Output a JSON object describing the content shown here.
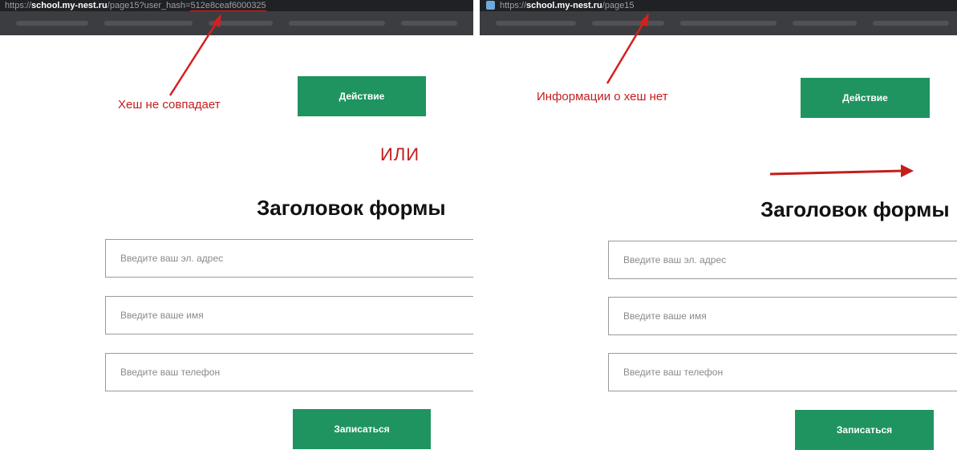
{
  "left": {
    "address": {
      "protocol": "https://",
      "domain": "school.my-nest.ru",
      "path": "/page15?user_hash=",
      "hash": "512e8ceaf6000325"
    },
    "annotation": "Хеш не совпадает",
    "action_button": "Действие",
    "or_label": "ИЛИ",
    "form": {
      "title": "Заголовок формы",
      "email_placeholder": "Введите ваш эл. адрес",
      "name_placeholder": "Введите ваше имя",
      "phone_placeholder": "Введите ваш телефон",
      "submit": "Записаться"
    }
  },
  "right": {
    "address": {
      "protocol": "https://",
      "domain": "school.my-nest.ru",
      "path": "/page15"
    },
    "annotation": "Информации о хеш нет",
    "action_button": "Действие",
    "form": {
      "title": "Заголовок формы",
      "email_placeholder": "Введите ваш эл. адрес",
      "name_placeholder": "Введите ваше имя",
      "phone_placeholder": "Введите ваш телефон",
      "submit": "Записаться"
    }
  },
  "colors": {
    "button": "#1f9461",
    "annotation": "#c41d1d",
    "address_bar": "#202124",
    "bookmarks_bar": "#3c3d41"
  }
}
